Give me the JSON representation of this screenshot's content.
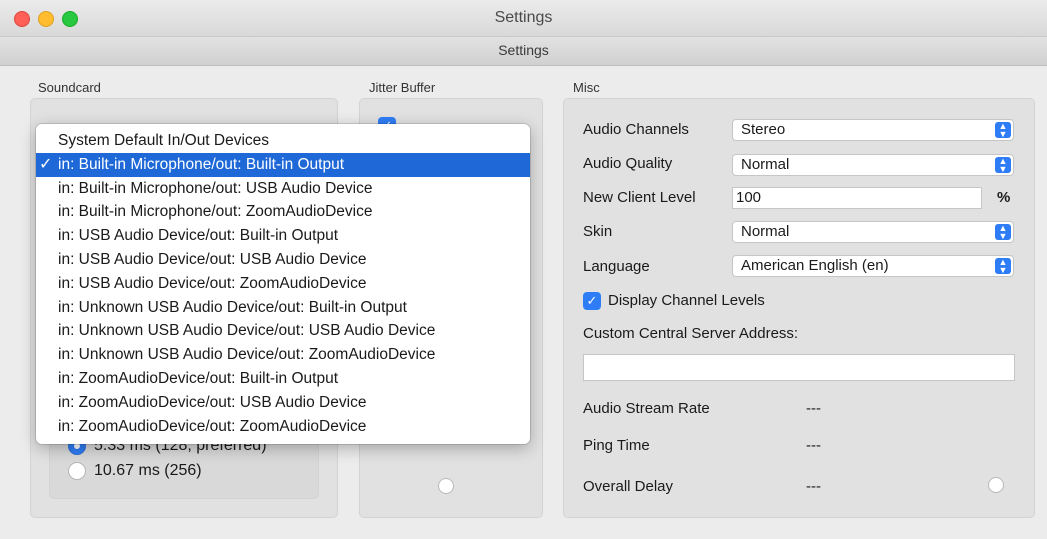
{
  "window": {
    "title": "Settings",
    "tab_title": "Settings"
  },
  "sections": {
    "soundcard": "Soundcard",
    "jitter_buffer": "Jitter Buffer",
    "misc": "Misc"
  },
  "soundcard": {
    "device_options": [
      "System Default In/Out Devices",
      "in: Built-in Microphone/out: Built-in Output",
      "in: Built-in Microphone/out: USB Audio Device",
      "in: Built-in Microphone/out: ZoomAudioDevice",
      "in: USB Audio Device/out: Built-in Output",
      "in: USB Audio Device/out: USB Audio Device",
      "in: USB Audio Device/out: ZoomAudioDevice",
      "in: Unknown USB Audio Device/out: Built-in Output",
      "in: Unknown USB Audio Device/out: USB Audio Device",
      "in: Unknown USB Audio Device/out: ZoomAudioDevice",
      "in: ZoomAudioDevice/out: Built-in Output",
      "in: ZoomAudioDevice/out: USB Audio Device",
      "in: ZoomAudioDevice/out: ZoomAudioDevice"
    ],
    "selected_index": 1,
    "check_mark": "✓",
    "buffer_options": [
      {
        "label": "5.33 ms (128, preferred)",
        "checked": true
      },
      {
        "label": "10.67 ms (256)",
        "checked": false
      }
    ]
  },
  "jitter": {
    "auto_checked": true
  },
  "misc": {
    "audio_channels": {
      "label": "Audio Channels",
      "value": "Stereo"
    },
    "audio_quality": {
      "label": "Audio Quality",
      "value": "Normal"
    },
    "new_client_level": {
      "label": "New Client Level",
      "value": "100",
      "unit": "%"
    },
    "skin": {
      "label": "Skin",
      "value": "Normal"
    },
    "language": {
      "label": "Language",
      "value": "American English (en)"
    },
    "display_channel_levels": {
      "label": "Display Channel Levels",
      "checked": true,
      "check_mark": "✓"
    },
    "custom_server": {
      "label": "Custom Central Server Address:",
      "value": ""
    },
    "audio_stream_rate": {
      "label": "Audio Stream Rate",
      "value": "---"
    },
    "ping_time": {
      "label": "Ping Time",
      "value": "---"
    },
    "overall_delay": {
      "label": "Overall Delay",
      "value": "---"
    }
  },
  "colors": {
    "accent": "#2f7df6",
    "selection": "#1f68d8"
  }
}
